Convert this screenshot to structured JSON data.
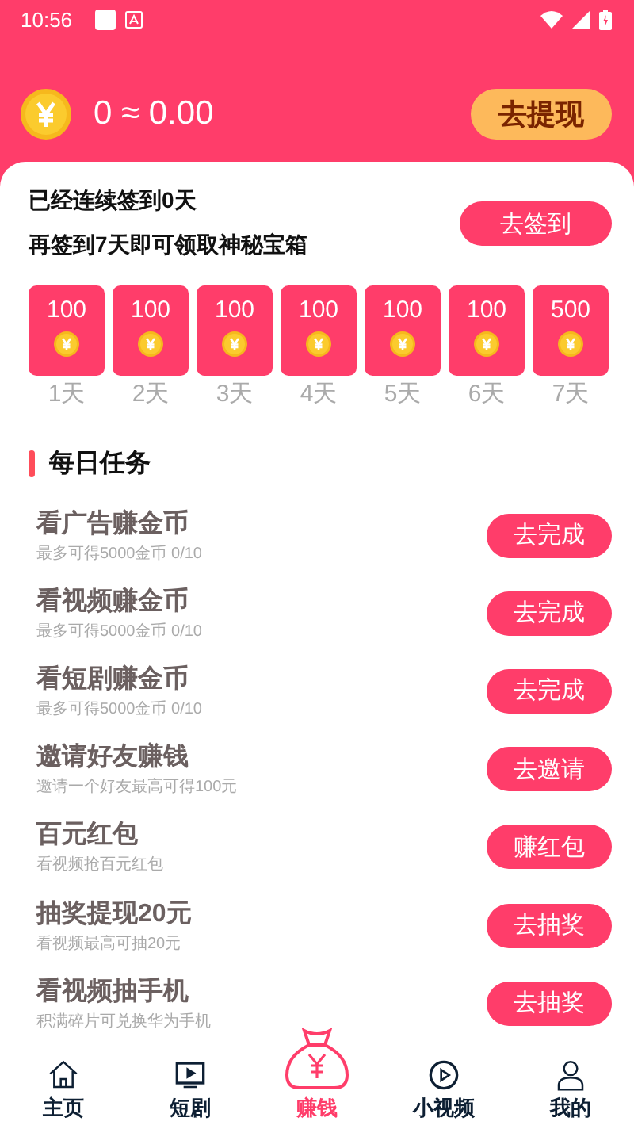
{
  "status_bar": {
    "time": "10:56"
  },
  "wallet": {
    "amount": "0 ≈ 0.00",
    "withdraw_button": "去提现"
  },
  "checkin": {
    "streak_text": "已经连续签到0天",
    "hint_text": "再签到7天即可领取神秘宝箱",
    "button": "去签到",
    "days": [
      {
        "reward": "100",
        "label": "1天"
      },
      {
        "reward": "100",
        "label": "2天"
      },
      {
        "reward": "100",
        "label": "3天"
      },
      {
        "reward": "100",
        "label": "4天"
      },
      {
        "reward": "100",
        "label": "5天"
      },
      {
        "reward": "100",
        "label": "6天"
      },
      {
        "reward": "500",
        "label": "7天"
      }
    ]
  },
  "daily_tasks": {
    "title": "每日任务",
    "tasks": [
      {
        "title": "看广告赚金币",
        "subtitle": "最多可得5000金币  0/10",
        "button": "去完成"
      },
      {
        "title": "看视频赚金币",
        "subtitle": "最多可得5000金币  0/10",
        "button": "去完成"
      },
      {
        "title": "看短剧赚金币",
        "subtitle": "最多可得5000金币  0/10",
        "button": "去完成"
      },
      {
        "title": "邀请好友赚钱",
        "subtitle": "邀请一个好友最高可得100元",
        "button": "去邀请"
      },
      {
        "title": "百元红包",
        "subtitle": "看视频抢百元红包",
        "button": "赚红包"
      },
      {
        "title": "抽奖提现20元",
        "subtitle": "看视频最高可抽20元",
        "button": "去抽奖"
      },
      {
        "title": "看视频抽手机",
        "subtitle": "积满碎片可兑换华为手机",
        "button": "去抽奖"
      }
    ]
  },
  "bottom_nav": [
    {
      "label": "主页",
      "kind": "home",
      "selected": false
    },
    {
      "label": "短剧",
      "kind": "tv",
      "selected": false
    },
    {
      "label": "赚钱",
      "kind": "bag",
      "selected": true
    },
    {
      "label": "小视频",
      "kind": "play",
      "selected": false
    },
    {
      "label": "我的",
      "kind": "person",
      "selected": false
    }
  ]
}
